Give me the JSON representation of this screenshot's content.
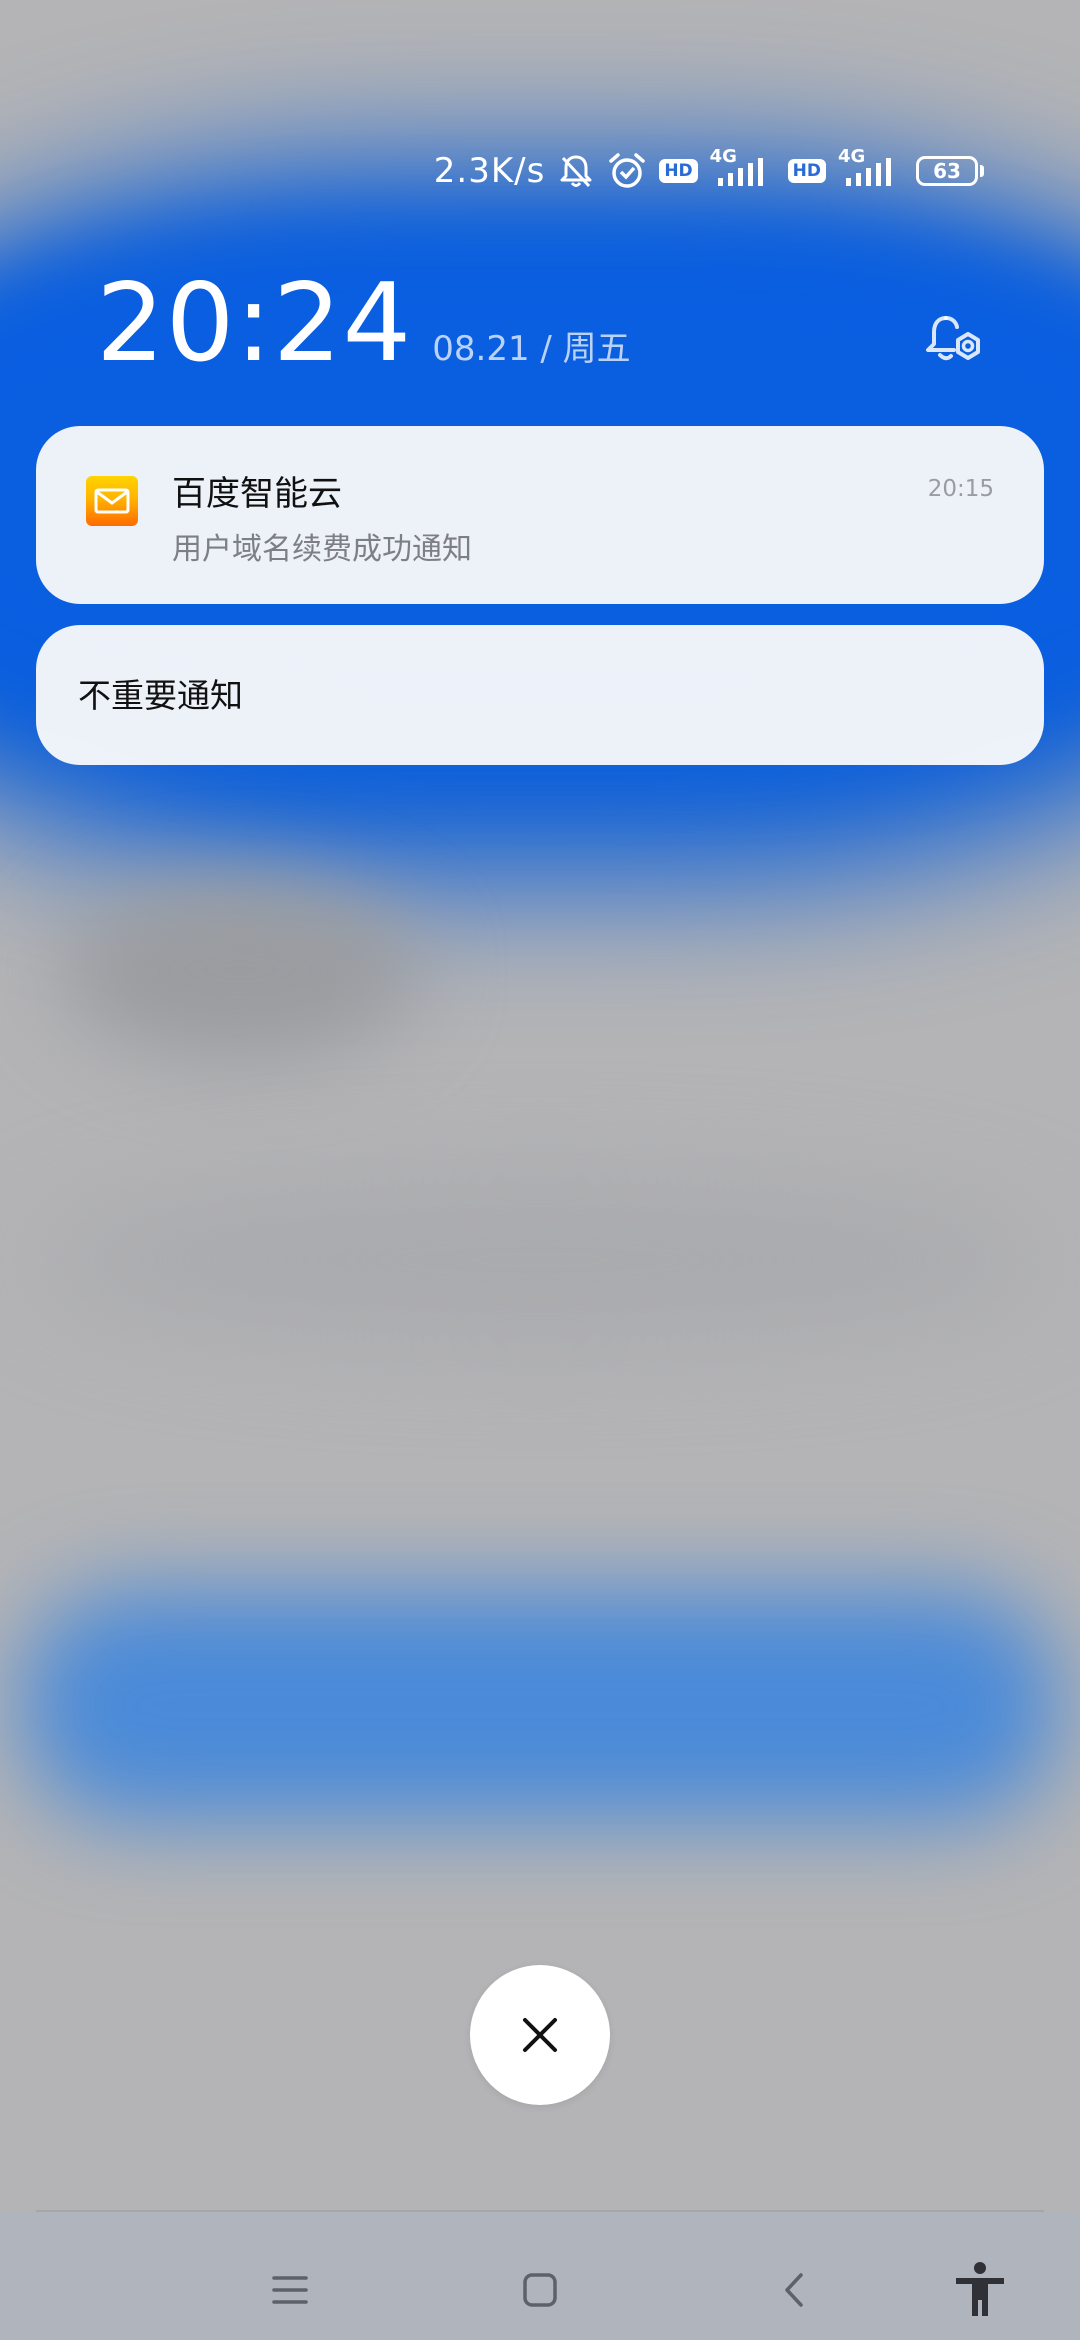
{
  "status_bar": {
    "net_speed": "2.3K/s",
    "hd_badge": "HD",
    "network_type": "4G",
    "battery_level": "63",
    "icons": [
      "bell-muted-icon",
      "alarm-icon",
      "hd-icon",
      "signal-4g-icon",
      "hd-icon",
      "signal-4g-icon",
      "battery-icon"
    ]
  },
  "header": {
    "clock": "20:24",
    "date": "08.21 / 周五",
    "settings_icon": "notification-settings-icon"
  },
  "notifications": [
    {
      "app_name": "百度智能云",
      "time": "20:15",
      "body": "用户域名续费成功通知",
      "icon": "mail-icon"
    }
  ],
  "folded_group": {
    "label": "不重要通知"
  },
  "close_button": {
    "icon": "close-icon"
  },
  "nav_bar": {
    "items": [
      "menu-icon",
      "home-icon",
      "back-icon",
      "accessibility-icon"
    ]
  },
  "colors": {
    "accent_blue": "#0c5fd8",
    "card_bg": "#f7f8fa",
    "muted_text": "#7d7f84",
    "backdrop_grey": "#b4b4b6"
  }
}
